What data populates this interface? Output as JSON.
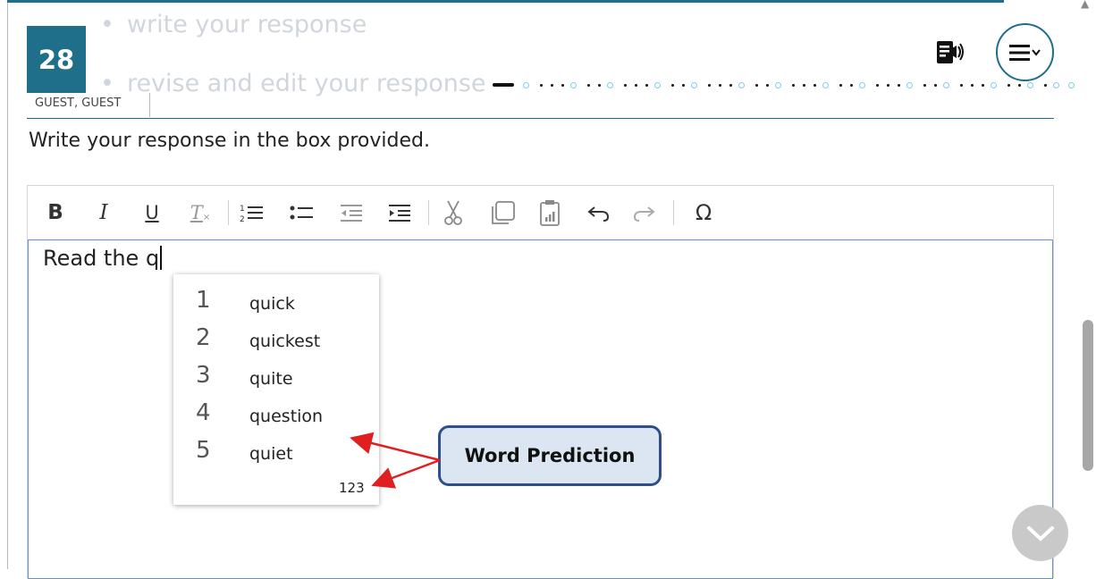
{
  "question": {
    "number": "28"
  },
  "instructions_ghost": [
    "write your response",
    "revise and edit your response"
  ],
  "user": {
    "name": "GUEST, GUEST"
  },
  "header": {
    "tts_icon": "text-to-speech-icon",
    "menu_icon": "hamburger-menu-icon"
  },
  "prompt": "Write your response in the box provided.",
  "toolbar": {
    "bold": "B",
    "italic": "I",
    "underline": "U",
    "remove_format": "T",
    "special_char": "Ω",
    "buttons": [
      "bold",
      "italic",
      "underline",
      "remove-format",
      "numbered-list",
      "bulleted-list",
      "outdent",
      "indent",
      "cut",
      "copy",
      "paste",
      "undo",
      "redo",
      "special-character"
    ]
  },
  "editor": {
    "text": "Read the q"
  },
  "word_prediction": {
    "suggestions": [
      {
        "num": "1",
        "word": "quick"
      },
      {
        "num": "2",
        "word": "quickest"
      },
      {
        "num": "3",
        "word": "quite"
      },
      {
        "num": "4",
        "word": "question"
      },
      {
        "num": "5",
        "word": "quiet"
      }
    ],
    "footer": "123"
  },
  "callout": {
    "label": "Word Prediction"
  },
  "colors": {
    "accent": "#1f6e8a",
    "callout_bg": "#dce6f2",
    "callout_border": "#2e4f8a",
    "arrow": "#e02020"
  }
}
